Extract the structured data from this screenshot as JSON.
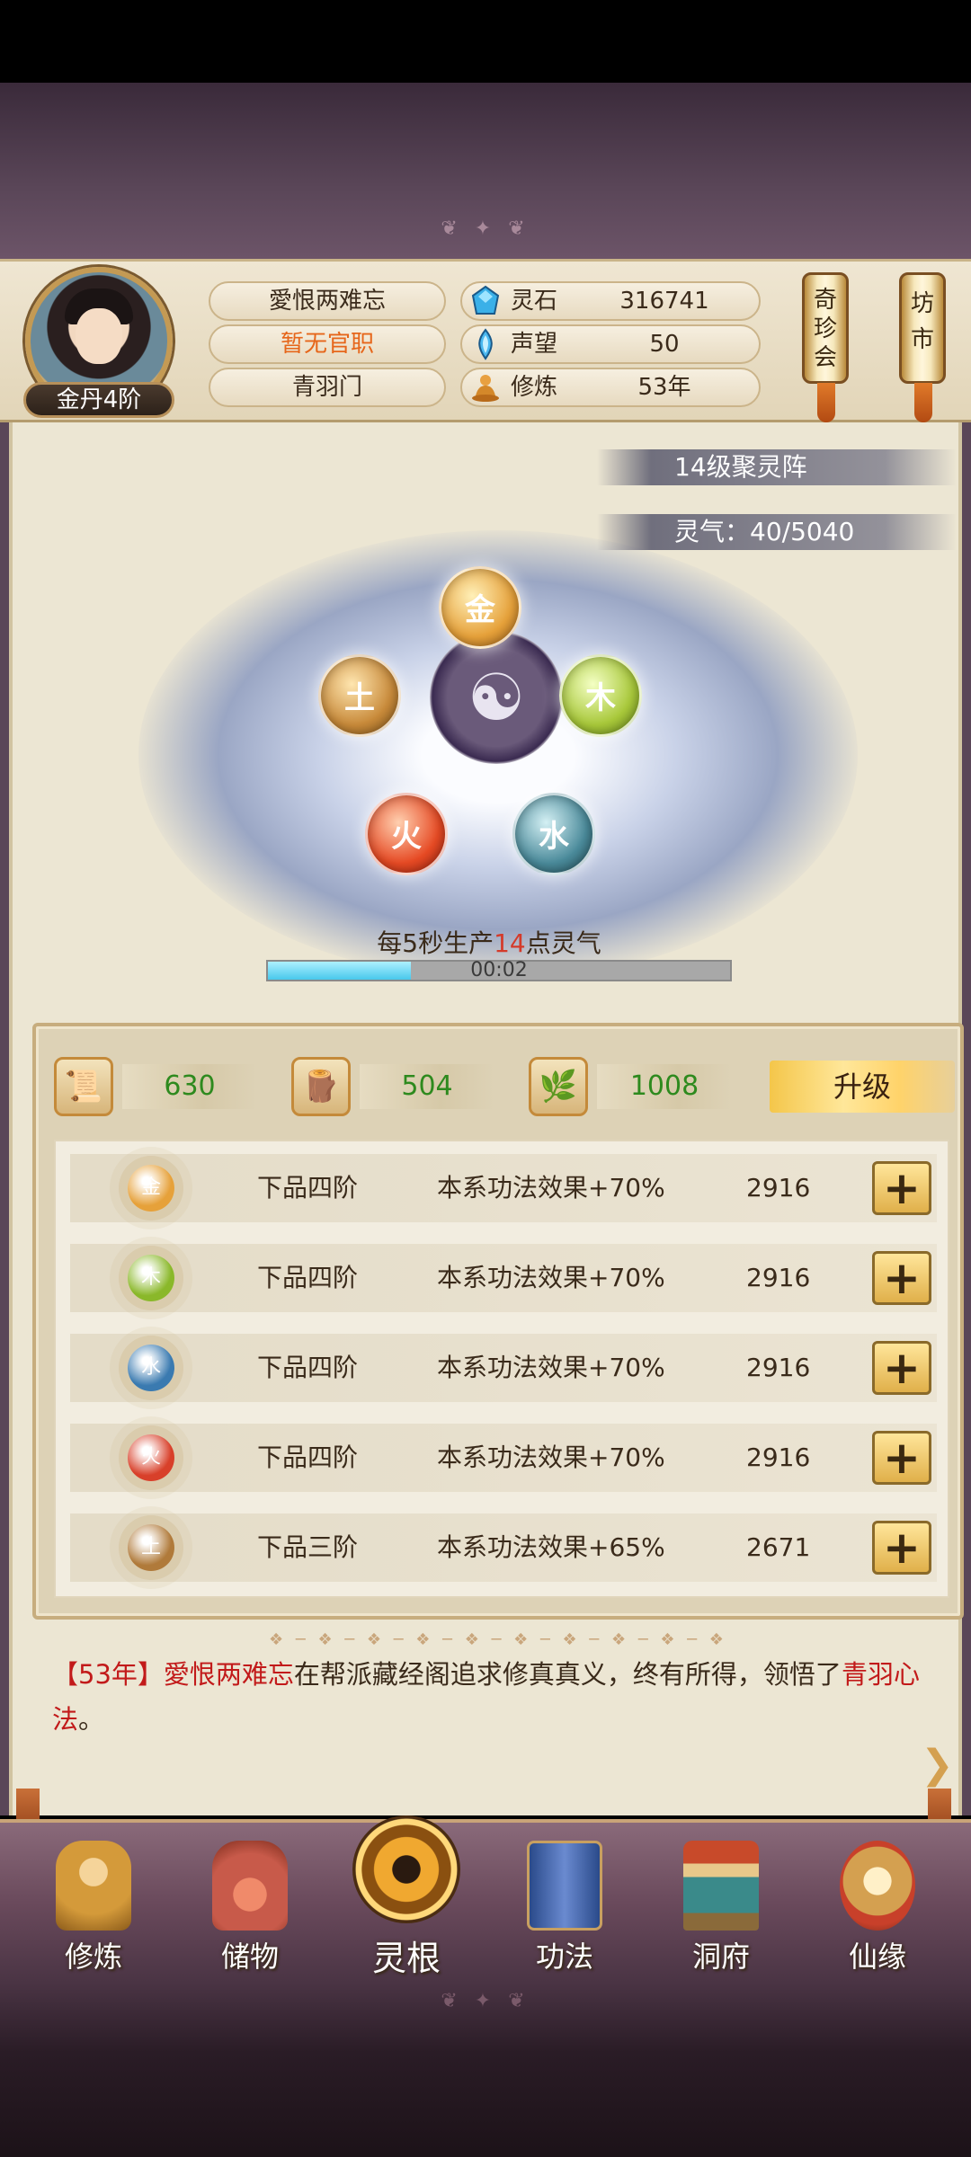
{
  "header": {
    "rank_badge": "金丹4阶",
    "name": "愛恨两难忘",
    "official_post": "暂无官职",
    "sect": "青羽门",
    "resources": [
      {
        "icon": "spirit-stone-icon",
        "label": "灵石",
        "value": "316741"
      },
      {
        "icon": "reputation-icon",
        "label": "声望",
        "value": "50"
      },
      {
        "icon": "cultivation-icon",
        "label": "修炼",
        "value": "53年"
      }
    ],
    "shortcuts": [
      {
        "label": "奇珍会"
      },
      {
        "label": "坊市"
      }
    ]
  },
  "formation": {
    "level_label": "14级聚灵阵",
    "qi_label": "灵气：40/5040",
    "elements": [
      "金",
      "木",
      "水",
      "火",
      "土"
    ],
    "production_prefix": "每5秒生产",
    "production_amount": "14",
    "production_suffix": "点灵气",
    "timer": "00:02",
    "progress": 0.31
  },
  "materials": [
    {
      "icon": "book-icon",
      "value": "630"
    },
    {
      "icon": "wood-bundle-icon",
      "value": "504"
    },
    {
      "icon": "herb-icon",
      "value": "1008"
    }
  ],
  "upgrade_label": "升级",
  "roots": [
    {
      "element": "金",
      "color": "#e6a13a",
      "grade": "下品四阶",
      "effect": "本系功法效果+70%",
      "cost": "2916"
    },
    {
      "element": "木",
      "color": "#8ab82a",
      "grade": "下品四阶",
      "effect": "本系功法效果+70%",
      "cost": "2916"
    },
    {
      "element": "水",
      "color": "#3a7ab0",
      "grade": "下品四阶",
      "effect": "本系功法效果+70%",
      "cost": "2916"
    },
    {
      "element": "火",
      "color": "#d8402a",
      "grade": "下品四阶",
      "effect": "本系功法效果+70%",
      "cost": "2916"
    },
    {
      "element": "土",
      "color": "#b07a3a",
      "grade": "下品三阶",
      "effect": "本系功法效果+65%",
      "cost": "2671"
    }
  ],
  "log": {
    "year": "【53年】",
    "name": "愛恨两难忘",
    "text": "在帮派藏经阁追求修真真义，终有所得，领悟了",
    "skill": "青羽心法",
    "end": "。"
  },
  "nav": [
    {
      "label": "修炼",
      "icon": "monk-icon",
      "color": "#d49a3a"
    },
    {
      "label": "储物",
      "icon": "bag-icon",
      "color": "#c85a4a"
    },
    {
      "label": "灵根",
      "icon": "spirit-root-icon",
      "color": "#f0a830"
    },
    {
      "label": "功法",
      "icon": "scroll-book-icon",
      "color": "#4a6aa8"
    },
    {
      "label": "洞府",
      "icon": "cave-house-icon",
      "color": "#8a6a3a"
    },
    {
      "label": "仙缘",
      "icon": "gourd-icon",
      "color": "#c8a060"
    }
  ]
}
